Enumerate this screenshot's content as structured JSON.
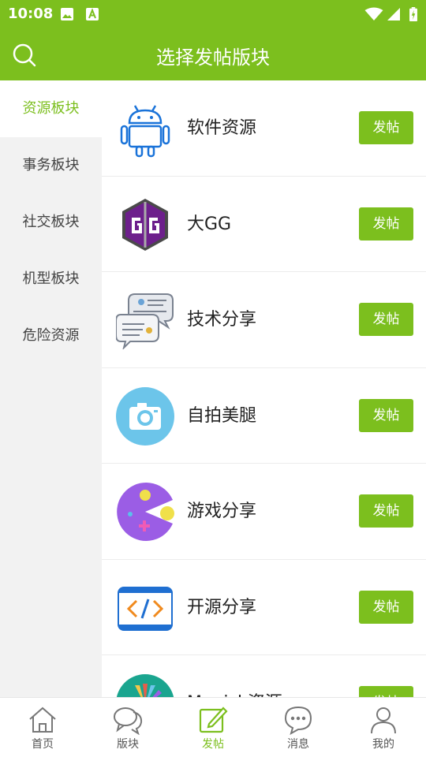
{
  "status_bar": {
    "time": "10:08"
  },
  "header": {
    "title": "选择发帖版块"
  },
  "sidebar": {
    "items": [
      {
        "label": "资源板块"
      },
      {
        "label": "事务板块"
      },
      {
        "label": "社交板块"
      },
      {
        "label": "机型板块"
      },
      {
        "label": "危险资源"
      }
    ],
    "selected_index": 0
  },
  "forums": [
    {
      "name": "软件资源",
      "icon": "android-icon",
      "button": "发帖"
    },
    {
      "name": "大GG",
      "icon": "gameguardian-icon",
      "button": "发帖"
    },
    {
      "name": "技术分享",
      "icon": "chat-bubbles-icon",
      "button": "发帖"
    },
    {
      "name": "自拍美腿",
      "icon": "camera-icon",
      "button": "发帖"
    },
    {
      "name": "游戏分享",
      "icon": "game-pacman-icon",
      "button": "发帖"
    },
    {
      "name": "开源分享",
      "icon": "code-icon",
      "button": "发帖"
    },
    {
      "name": "Magisk资源",
      "icon": "magisk-icon",
      "button": "发帖"
    }
  ],
  "bottom_nav": [
    {
      "label": "首页",
      "icon": "home-icon"
    },
    {
      "label": "版块",
      "icon": "forum-bubbles-icon"
    },
    {
      "label": "发帖",
      "icon": "edit-icon"
    },
    {
      "label": "消息",
      "icon": "message-icon"
    },
    {
      "label": "我的",
      "icon": "user-icon"
    }
  ],
  "bottom_nav_selected_index": 2,
  "colors": {
    "accent": "#7cbf1e",
    "sidebar_bg": "#f2f2f2"
  }
}
